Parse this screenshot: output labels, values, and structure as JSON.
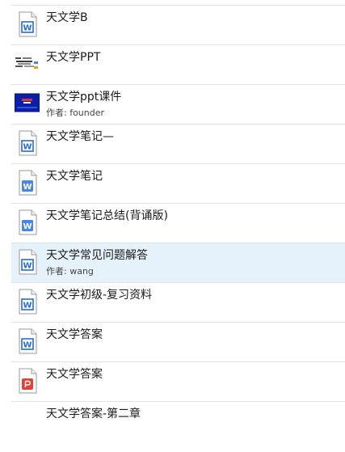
{
  "files": [
    {
      "name": "天文学B",
      "type": "word-doc",
      "icon": "word-doc-icon",
      "meta": "",
      "selected": false
    },
    {
      "name": "天文学PPT",
      "type": "image-thumbnail",
      "icon": "image-thumbnail-icon",
      "meta": "",
      "selected": false
    },
    {
      "name": "天文学ppt课件",
      "type": "ppt-thumbnail",
      "icon": "ppt-thumbnail-icon",
      "meta": "作者: founder",
      "selected": false
    },
    {
      "name": "天文学笔记—",
      "type": "word-doc",
      "icon": "word-doc-icon",
      "meta": "",
      "selected": false
    },
    {
      "name": "天文学笔记",
      "type": "word-doc-modern",
      "icon": "word-doc-icon",
      "meta": "",
      "selected": false
    },
    {
      "name": "天文学笔记总结(背诵版)",
      "type": "word-doc-modern",
      "icon": "word-doc-icon",
      "meta": "",
      "selected": false
    },
    {
      "name": "天文学常见问题解答",
      "type": "word-doc",
      "icon": "word-doc-icon",
      "meta": "作者: wang",
      "selected": true
    },
    {
      "name": "天文学初级-复习资料",
      "type": "word-doc",
      "icon": "word-doc-icon",
      "meta": "",
      "selected": false
    },
    {
      "name": "天文学答案",
      "type": "word-doc",
      "icon": "word-doc-icon",
      "meta": "",
      "selected": false
    },
    {
      "name": "天文学答案",
      "type": "pdf-doc",
      "icon": "pdf-doc-icon",
      "meta": "",
      "selected": false
    },
    {
      "name": "天文学答案-第二章",
      "type": "none",
      "icon": "",
      "meta": "",
      "selected": false
    }
  ],
  "colors": {
    "word_blue": "#2b6cc4",
    "word_blue_modern": "#4a86e8",
    "pdf_red": "#e0433b",
    "selection": "#e6f2fb"
  }
}
